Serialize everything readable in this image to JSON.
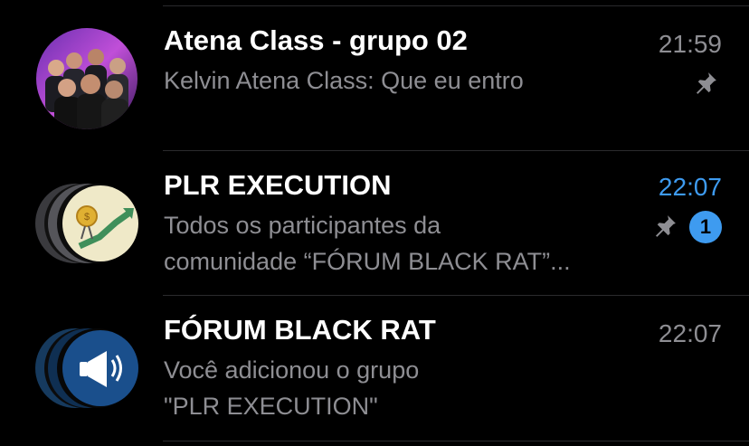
{
  "chats": [
    {
      "title": "Atena Class - grupo 02",
      "sender": "Kelvin Atena Class",
      "message": "Que eu entro",
      "time": "21:59",
      "pinned": true,
      "icon": "group-photo-avatar"
    },
    {
      "title": "PLR EXECUTION",
      "preview_line1": "Todos os participantes da",
      "preview_line2": "comunidade “FÓRUM BLACK RAT”...",
      "time": "22:07",
      "pinned": true,
      "unread": "1",
      "icon": "coin-growth-avatar"
    },
    {
      "title": "FÓRUM BLACK RAT",
      "preview_line1": "Você adicionou o grupo",
      "preview_line2": "\"PLR EXECUTION\"",
      "time": "22:07",
      "icon": "megaphone-community-avatar"
    }
  ],
  "colors": {
    "background": "#000000",
    "secondary_text": "#8e8e93",
    "accent": "#3e9bf0",
    "separator": "#2a2a2d"
  }
}
